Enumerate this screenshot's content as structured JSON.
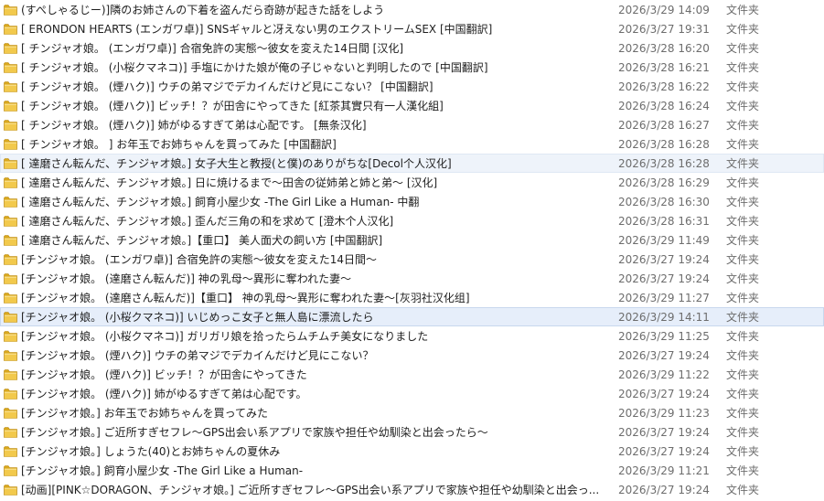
{
  "icons": {
    "folder": "folder-icon"
  },
  "colors": {
    "folder_front": "#f2c94c",
    "folder_back": "#d9a81e",
    "hover_bg": "#eef3fa",
    "selected_bg": "#e6eefa"
  },
  "files": [
    {
      "name": "(すぺしゃるじー)]隣のお姉さんの下着を盗んだら奇跡が起きた話をしよう",
      "date": "2026/3/29 14:09",
      "type": "文件夹"
    },
    {
      "name": "[ ERONDON HEARTS (エンガワ卓)] SNSギャルと冴えない男のエクストリームSEX [中国翻訳]",
      "date": "2026/3/27 19:31",
      "type": "文件夹"
    },
    {
      "name": "[ チンジャオ娘。 (エンガワ卓)] 合宿免許の実態～彼女を変えた14日間 [汉化]",
      "date": "2026/3/28 16:20",
      "type": "文件夹"
    },
    {
      "name": "[ チンジャオ娘。 (小桜クマネコ)] 手塩にかけた娘が俺の子じゃないと判明したので [中国翻訳]",
      "date": "2026/3/28 16:21",
      "type": "文件夹"
    },
    {
      "name": "[ チンジャオ娘。 (煙ハク)] ウチの弟マジでデカイんだけど見にこない？ [中国翻訳]",
      "date": "2026/3/28 16:22",
      "type": "文件夹"
    },
    {
      "name": "[ チンジャオ娘。 (煙ハク)] ビッチ！？が田舎にやってきた [紅茶其實只有一人漢化組]",
      "date": "2026/3/28 16:24",
      "type": "文件夹"
    },
    {
      "name": "[ チンジャオ娘。 (煙ハク)] 姉がゆるすぎて弟は心配です。 [無条汉化]",
      "date": "2026/3/28 16:27",
      "type": "文件夹"
    },
    {
      "name": "[ チンジャオ娘。 ] お年玉でお姉ちゃんを買ってみた [中国翻訳]",
      "date": "2026/3/28 16:28",
      "type": "文件夹"
    },
    {
      "name": "[ 達磨さん転んだ、チンジャオ娘。] 女子大生と教授(と僕)のありがちな[Decol个人汉化]",
      "date": "2026/3/28 16:28",
      "type": "文件夹"
    },
    {
      "name": "[ 達磨さん転んだ、チンジャオ娘。] 日に焼けるまで～田舎の従姉弟と姉と弟～ [汉化]",
      "date": "2026/3/28 16:29",
      "type": "文件夹"
    },
    {
      "name": "[ 達磨さん転んだ、チンジャオ娘。] 飼育小屋少女 -The Girl Like a Human- 中翻",
      "date": "2026/3/28 16:30",
      "type": "文件夹"
    },
    {
      "name": "[ 達磨さん転んだ、チンジャオ娘。] 歪んだ三角の和を求めて [澄木个人汉化]",
      "date": "2026/3/28 16:31",
      "type": "文件夹"
    },
    {
      "name": "[ 達磨さん転んだ、チンジャオ娘。]【重口】 美人面犬の飼い方 [中国翻訳]",
      "date": "2026/3/29 11:49",
      "type": "文件夹"
    },
    {
      "name": "[チンジャオ娘。 (エンガワ卓)] 合宿免許の実態～彼女を変えた14日間～",
      "date": "2026/3/27 19:24",
      "type": "文件夹"
    },
    {
      "name": "[チンジャオ娘。 (達磨さん転んだ)] 神の乳母～異形に奪われた妻～",
      "date": "2026/3/27 19:24",
      "type": "文件夹"
    },
    {
      "name": "[チンジャオ娘。 (達磨さん転んだ)]【重口】 神の乳母～異形に奪われた妻～[灰羽社汉化组]",
      "date": "2026/3/29 11:27",
      "type": "文件夹"
    },
    {
      "name": "[チンジャオ娘。 (小桜クマネコ)] いじめっこ女子と無人島に漂流したら",
      "date": "2026/3/29 14:11",
      "type": "文件夹"
    },
    {
      "name": "[チンジャオ娘。 (小桜クマネコ)] ガリガリ娘を拾ったらムチムチ美女になりました",
      "date": "2026/3/29 11:25",
      "type": "文件夹"
    },
    {
      "name": "[チンジャオ娘。 (煙ハク)] ウチの弟マジでデカイんだけど見にこない？",
      "date": "2026/3/27 19:24",
      "type": "文件夹"
    },
    {
      "name": "[チンジャオ娘。 (煙ハク)] ビッチ！？が田舎にやってきた",
      "date": "2026/3/29 11:22",
      "type": "文件夹"
    },
    {
      "name": "[チンジャオ娘。 (煙ハク)] 姉がゆるすぎて弟は心配です。",
      "date": "2026/3/27 19:24",
      "type": "文件夹"
    },
    {
      "name": "[チンジャオ娘。] お年玉でお姉ちゃんを買ってみた",
      "date": "2026/3/29 11:23",
      "type": "文件夹"
    },
    {
      "name": "[チンジャオ娘。] ご近所すぎセフレ～GPS出会い系アプリで家族や担任や幼馴染と出会ったら～",
      "date": "2026/3/27 19:24",
      "type": "文件夹"
    },
    {
      "name": "[チンジャオ娘。] しょうた(40)とお姉ちゃんの夏休み",
      "date": "2026/3/27 19:24",
      "type": "文件夹"
    },
    {
      "name": "[チンジャオ娘。] 飼育小屋少女 -The Girl Like a Human-",
      "date": "2026/3/29 11:21",
      "type": "文件夹"
    },
    {
      "name": "[动画][PINK☆DORAGON、チンジャオ娘。] ご近所すぎセフレ～GPS出会い系アプリで家族や担任や幼馴染と出会っ...",
      "date": "2026/3/27 19:24",
      "type": "文件夹"
    }
  ],
  "hover_index": 8,
  "selected_index": 16
}
